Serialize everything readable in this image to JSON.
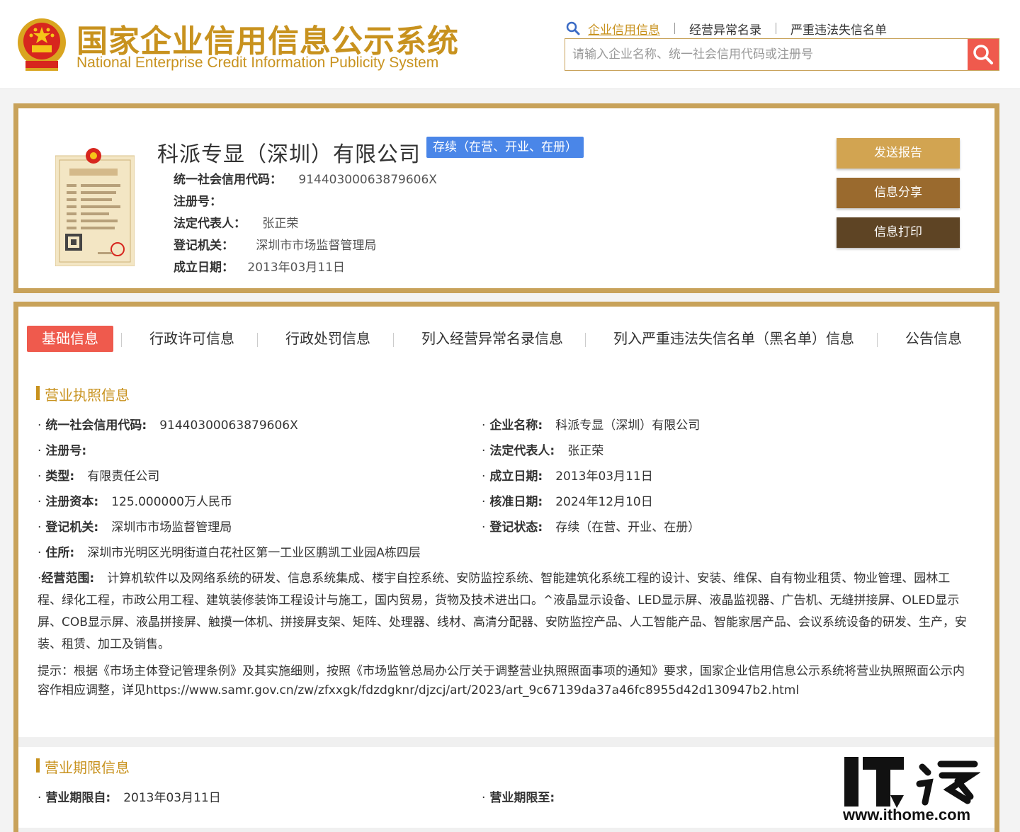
{
  "header": {
    "logo_cn": "国家企业信用信息公示系统",
    "logo_en": "National Enterprise Credit Information Publicity System",
    "search_tabs": [
      "企业信用信息",
      "经营异常名录",
      "严重违法失信名单"
    ],
    "search_placeholder": "请输入企业名称、统一社会信用代码或注册号"
  },
  "company": {
    "name": "科派专显（深圳）有限公司",
    "status": "存续（在营、开业、在册）",
    "fields": [
      {
        "label": "统一社会信用代码：",
        "value": "91440300063879606X"
      },
      {
        "label": "注册号：",
        "value": ""
      },
      {
        "label": "法定代表人：",
        "value": "张正荣"
      },
      {
        "label": "登记机关：",
        "value": "深圳市市场监督管理局"
      },
      {
        "label": "成立日期：",
        "value": "2013年03月11日"
      }
    ],
    "actions": [
      "发送报告",
      "信息分享",
      "信息打印"
    ]
  },
  "tabs": [
    "基础信息",
    "行政许可信息",
    "行政处罚信息",
    "列入经营异常名录信息",
    "列入严重违法失信名单（黑名单）信息",
    "公告信息"
  ],
  "license_section": {
    "title": "营业执照信息",
    "left": [
      {
        "label": "统一社会信用代码:",
        "value": "91440300063879606X"
      },
      {
        "label": "注册号:",
        "value": ""
      },
      {
        "label": "类型:",
        "value": "有限责任公司"
      },
      {
        "label": "注册资本:",
        "value": "125.000000万人民币"
      },
      {
        "label": "登记机关:",
        "value": "深圳市市场监督管理局"
      },
      {
        "label": "住所:",
        "value": "深圳市光明区光明街道白花社区第一工业区鹏凯工业园A栋四层"
      }
    ],
    "right": [
      {
        "label": "企业名称:",
        "value": "科派专显（深圳）有限公司"
      },
      {
        "label": "法定代表人:",
        "value": "张正荣"
      },
      {
        "label": "成立日期:",
        "value": "2013年03月11日"
      },
      {
        "label": "核准日期:",
        "value": "2024年12月10日"
      },
      {
        "label": "登记状态:",
        "value": "存续（在营、开业、在册）"
      }
    ],
    "scope_label": "经营范围:",
    "scope_value": "计算机软件以及网络系统的研发、信息系统集成、楼宇自控系统、安防监控系统、智能建筑化系统工程的设计、安装、维保、自有物业租赁、物业管理、园林工程、绿化工程，市政公用工程、建筑装修装饰工程设计与施工，国内贸易，货物及技术进出口。^液晶显示设备、LED显示屏、液晶监视器、广告机、无缝拼接屏、OLED显示屏、COB显示屏、液晶拼接屏、触摸一体机、拼接屏支架、矩阵、处理器、线材、高清分配器、安防监控产品、人工智能产品、智能家居产品、会议系统设备的研发、生产，安装、租赁、加工及销售。",
    "tip": "提示：根据《市场主体登记管理条例》及其实施细则，按照《市场监管总局办公厅关于调整营业执照照面事项的通知》要求，国家企业信用信息公示系统将营业执照照面公示内容作相应调整，详见https://www.samr.gov.cn/zw/zfxxgk/fdzdgknr/djzcj/art/2023/art_9c67139da37a46fc8955d42d130947b2.html"
  },
  "period_section": {
    "title": "营业期限信息",
    "from_label": "营业期限自:",
    "from_value": "2013年03月11日",
    "to_label": "营业期限至:",
    "to_value": ""
  },
  "watermark": {
    "logo_text": "IT之家",
    "url": "www.ithome.com"
  },
  "colors": {
    "gold": "#c8a25a",
    "gold_text": "#c8921e",
    "red": "#ef5a4d",
    "blue_badge": "#4a86e8"
  }
}
